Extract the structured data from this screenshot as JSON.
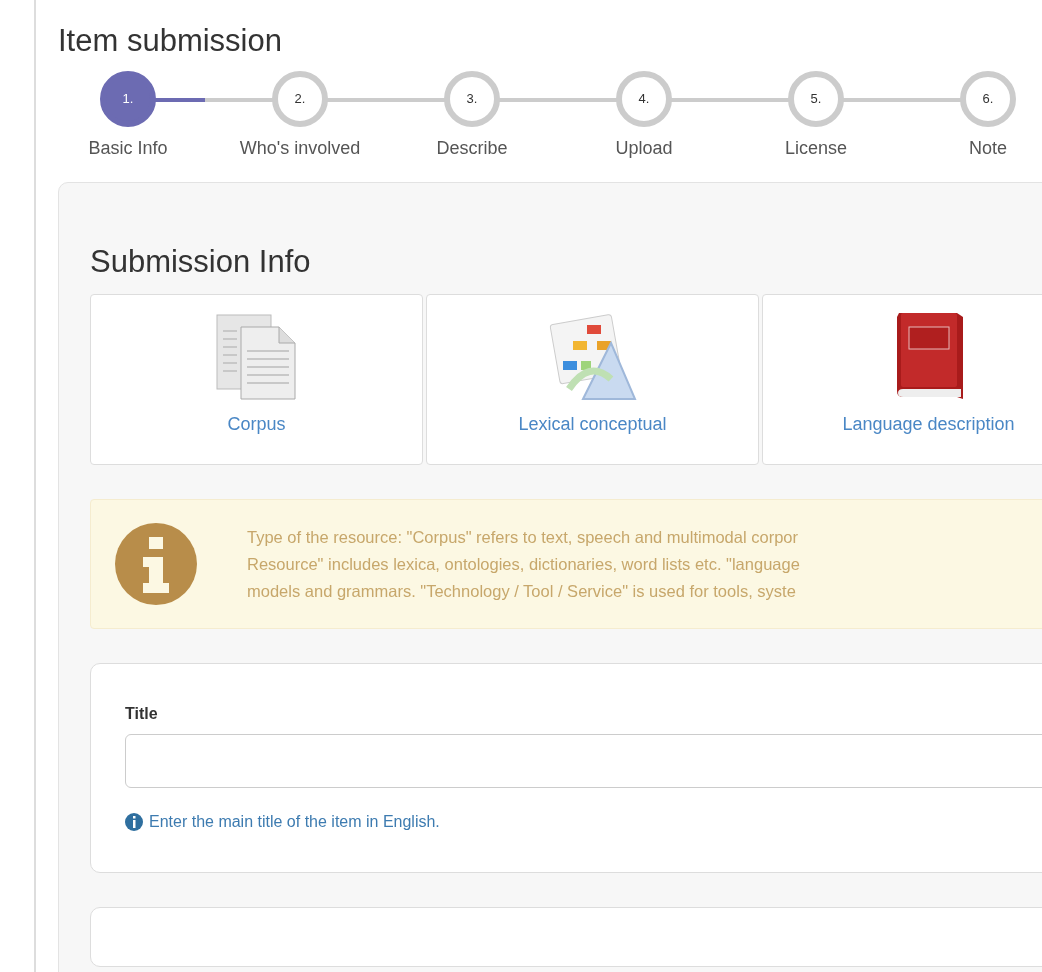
{
  "page_title": "Item submission",
  "steps": [
    {
      "number": "1.",
      "label": "Basic Info",
      "selected": true
    },
    {
      "number": "2.",
      "label": "Who's involved",
      "selected": false
    },
    {
      "number": "3.",
      "label": "Describe",
      "selected": false
    },
    {
      "number": "4.",
      "label": "Upload",
      "selected": false
    },
    {
      "number": "5.",
      "label": "License",
      "selected": false
    },
    {
      "number": "6.",
      "label": "Note",
      "selected": false
    }
  ],
  "section_title": "Submission Info",
  "resource_types": [
    {
      "kind": "documents",
      "label": "Corpus"
    },
    {
      "kind": "diagram",
      "label": "Lexical conceptual"
    },
    {
      "kind": "book",
      "label": "Language description"
    }
  ],
  "info_lines": [
    "Type of the resource: \"Corpus\" refers to text, speech and multimodal corpor",
    "Resource\" includes lexica, ontologies, dictionaries, word lists etc. \"language",
    "models and grammars. \"Technology / Tool / Service\" is used for tools, syste"
  ],
  "title_field": {
    "label": "Title",
    "help": "Enter the main title of the item in English."
  }
}
